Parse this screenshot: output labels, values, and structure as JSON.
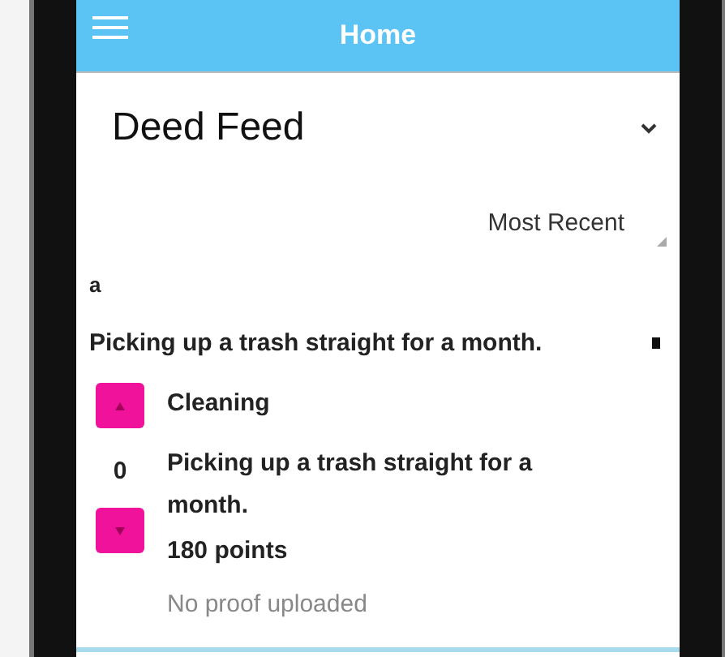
{
  "app_bar": {
    "title": "Home"
  },
  "feed": {
    "title": "Deed Feed",
    "sort": "Most Recent"
  },
  "post": {
    "author": "a",
    "title": "Picking up a trash straight for a month.",
    "category": "Cleaning",
    "score": "0",
    "description": "Picking up a trash straight for a month.",
    "points": "180 points",
    "proof": "No proof uploaded"
  }
}
